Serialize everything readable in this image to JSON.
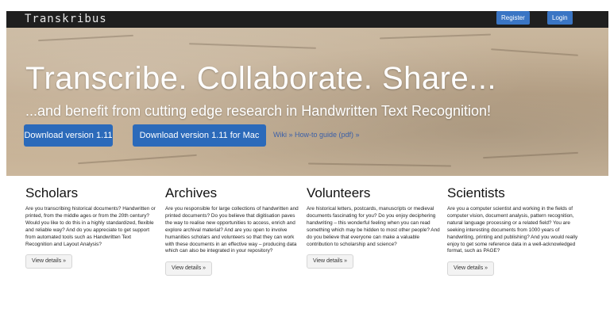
{
  "topbar": {
    "brand": "Transkribus",
    "register_label": "Register",
    "login_label": "Login"
  },
  "hero": {
    "title": "Transcribe. Collaborate. Share...",
    "subtitle": "...and benefit from cutting edge research in Handwritten Text Recognition!",
    "download_label": "Download version 1.11",
    "download_mac_label": "Download version 1.11 for Mac",
    "links": [
      {
        "label": "Wiki »"
      },
      {
        "label": "How-to guide (pdf) »"
      }
    ]
  },
  "columns": [
    {
      "title": "Scholars",
      "text": "Are you transcribing historical documents? Handwritten or printed, from the middle ages or from the 20th century? Would you like to do this in a highly standardized, flexible and reliable way? And do you appreciate to get support from automated tools such as Handwritten Text Recognition and Layout Analysis?",
      "button": "View details »"
    },
    {
      "title": "Archives",
      "text": "Are you responsible for large collections of handwritten and printed documents? Do you believe that digitisation paves the way to realise new opportunities to access, enrich and explore archival material? And are you open to involve humanities scholars and volunteers so that they can work with these documents in an effective way – producing data which can also be integrated in your repository?",
      "button": "View details »"
    },
    {
      "title": "Volunteers",
      "text": "Are historical letters, postcards, manuscripts or medieval documents fascinating for you? Do you enjoy deciphering handwriting – this wonderful feeling when you can read something which may be hidden to most other people? And do you believe that everyone can make a valuable contribution to scholarship and science?",
      "button": "View details »"
    },
    {
      "title": "Scientists",
      "text": "Are you a computer scientist and working in the fields of computer vision, document analysis, pattern recognition, natural language processing or a related field? You are seeking interesting documents from 1000 years of handwriting, printing and publishing? And you would really enjoy to get some reference data in a well-acknowledged format, such as PAGE?",
      "button": "View details »"
    }
  ],
  "colors": {
    "topbar_bg": "#1f1f1f",
    "primary_button": "#2b6aba",
    "link": "#3b5fa8"
  }
}
